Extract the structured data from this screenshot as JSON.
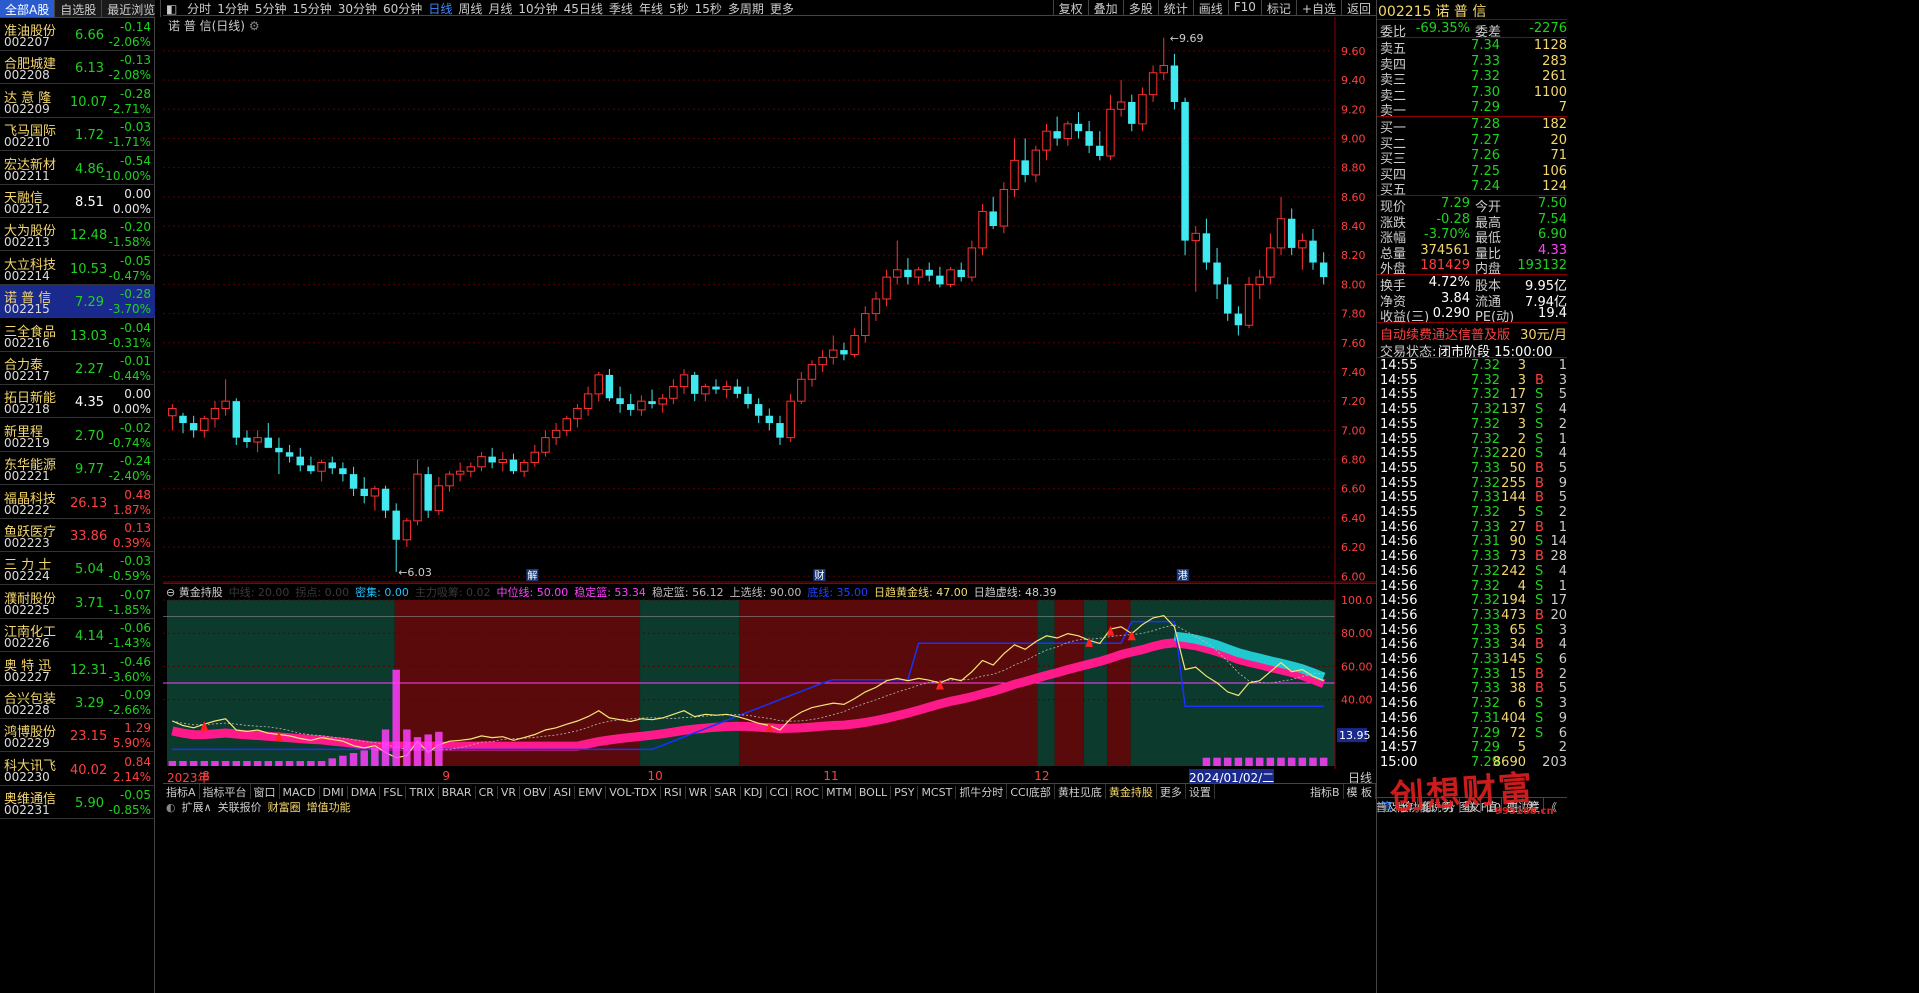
{
  "left_tabs": [
    "全部A股",
    "自选股",
    "最近浏览"
  ],
  "stocks": [
    {
      "name": "准油股份",
      "code": "002207",
      "price": "6.66",
      "chg": "-0.14",
      "pct": "-2.06%",
      "dir": "dn"
    },
    {
      "name": "合肥城建",
      "code": "002208",
      "price": "6.13",
      "chg": "-0.13",
      "pct": "-2.08%",
      "dir": "dn"
    },
    {
      "name": "达 意 隆",
      "code": "002209",
      "price": "10.07",
      "chg": "-0.28",
      "pct": "-2.71%",
      "dir": "dn"
    },
    {
      "name": "飞马国际",
      "code": "002210",
      "price": "1.72",
      "chg": "-0.03",
      "pct": "-1.71%",
      "dir": "dn"
    },
    {
      "name": "宏达新材",
      "code": "002211",
      "price": "4.86",
      "chg": "-0.54",
      "pct": "-10.00%",
      "dir": "dn"
    },
    {
      "name": "天融信",
      "code": "002212",
      "price": "8.51",
      "chg": "0.00",
      "pct": "0.00%",
      "dir": "fl"
    },
    {
      "name": "大为股份",
      "code": "002213",
      "price": "12.48",
      "chg": "-0.20",
      "pct": "-1.58%",
      "dir": "dn"
    },
    {
      "name": "大立科技",
      "code": "002214",
      "price": "10.53",
      "chg": "-0.05",
      "pct": "-0.47%",
      "dir": "dn"
    },
    {
      "name": "诺 普 信",
      "code": "002215",
      "price": "7.29",
      "chg": "-0.28",
      "pct": "-3.70%",
      "dir": "dn",
      "selected": true
    },
    {
      "name": "三全食品",
      "code": "002216",
      "price": "13.03",
      "chg": "-0.04",
      "pct": "-0.31%",
      "dir": "dn"
    },
    {
      "name": "合力泰",
      "code": "002217",
      "price": "2.27",
      "chg": "-0.01",
      "pct": "-0.44%",
      "dir": "dn"
    },
    {
      "name": "拓日新能",
      "code": "002218",
      "price": "4.35",
      "chg": "0.00",
      "pct": "0.00%",
      "dir": "fl"
    },
    {
      "name": "新里程",
      "code": "002219",
      "price": "2.70",
      "chg": "-0.02",
      "pct": "-0.74%",
      "dir": "dn"
    },
    {
      "name": "东华能源",
      "code": "002221",
      "price": "9.77",
      "chg": "-0.24",
      "pct": "-2.40%",
      "dir": "dn"
    },
    {
      "name": "福晶科技",
      "code": "002222",
      "price": "26.13",
      "chg": "0.48",
      "pct": "1.87%",
      "dir": "up"
    },
    {
      "name": "鱼跃医疗",
      "code": "002223",
      "price": "33.86",
      "chg": "0.13",
      "pct": "0.39%",
      "dir": "up"
    },
    {
      "name": "三 力 士",
      "code": "002224",
      "price": "5.04",
      "chg": "-0.03",
      "pct": "-0.59%",
      "dir": "dn"
    },
    {
      "name": "濮耐股份",
      "code": "002225",
      "price": "3.71",
      "chg": "-0.07",
      "pct": "-1.85%",
      "dir": "dn"
    },
    {
      "name": "江南化工",
      "code": "002226",
      "price": "4.14",
      "chg": "-0.06",
      "pct": "-1.43%",
      "dir": "dn"
    },
    {
      "name": "奥 特 迅",
      "code": "002227",
      "price": "12.31",
      "chg": "-0.46",
      "pct": "-3.60%",
      "dir": "dn"
    },
    {
      "name": "合兴包装",
      "code": "002228",
      "price": "3.29",
      "chg": "-0.09",
      "pct": "-2.66%",
      "dir": "dn"
    },
    {
      "name": "鸿博股份",
      "code": "002229",
      "price": "23.15",
      "chg": "1.29",
      "pct": "5.90%",
      "dir": "up"
    },
    {
      "name": "科大讯飞",
      "code": "002230",
      "price": "40.02",
      "chg": "0.84",
      "pct": "2.14%",
      "dir": "up"
    },
    {
      "name": "奥维通信",
      "code": "002231",
      "price": "5.90",
      "chg": "-0.05",
      "pct": "-0.85%",
      "dir": "dn"
    }
  ],
  "period_tabs": [
    "分时",
    "1分钟",
    "5分钟",
    "15分钟",
    "30分钟",
    "60分钟",
    "日线",
    "周线",
    "月线",
    "10分钟",
    "45日线",
    "季线",
    "年线",
    "5秒",
    "15秒",
    "多周期",
    "更多"
  ],
  "active_period": "日线",
  "right_tools": [
    "复权",
    "叠加",
    "多股",
    "统计",
    "画线",
    "F10",
    "标记",
    "+自选",
    "返回"
  ],
  "chart_title": "诺 普 信(日线)",
  "price_ticks": [
    "9.60",
    "9.40",
    "9.20",
    "9.00",
    "8.80",
    "8.60",
    "8.40",
    "8.20",
    "8.00",
    "7.80",
    "7.60",
    "7.40",
    "7.20",
    "7.00",
    "6.80",
    "6.60",
    "6.40",
    "6.20",
    "6.00"
  ],
  "annotations": {
    "high": "9.69",
    "low": "6.03",
    "marker1": "解",
    "marker2": "财",
    "marker3": "港"
  },
  "indicator": {
    "name": "黄金持股",
    "header": [
      {
        "t": "中线: 20.00",
        "c": "#3a3a3a"
      },
      {
        "t": "拐点: 0.00",
        "c": "#3a3a3a"
      },
      {
        "t": "密集: 0.00",
        "c": "#20c0ff"
      },
      {
        "t": "主力吸筹: 0.02",
        "c": "#3a3a3a"
      },
      {
        "t": "中位线: 50.00",
        "c": "#ff40ff"
      },
      {
        "t": "稳定篮: 53.34",
        "c": "#ff40ff"
      },
      {
        "t": "稳定篮: 56.12",
        "c": "#bbbbbb"
      },
      {
        "t": "上选线: 90.00",
        "c": "#bbbbbb"
      },
      {
        "t": "底线: 35.00",
        "c": "#2040ff"
      },
      {
        "t": "日趋黄金线: 47.00",
        "c": "#f5d76e"
      },
      {
        "t": "日趋虚线: 48.39",
        "c": "#cccccc"
      }
    ],
    "ticks": [
      "100.0",
      "80.00",
      "60.00",
      "40.00"
    ],
    "current_label": "13.95"
  },
  "date_labels": [
    {
      "t": "2023年",
      "x": 0.0
    },
    {
      "t": "8",
      "x": 0.03
    },
    {
      "t": "9",
      "x": 0.235
    },
    {
      "t": "10",
      "x": 0.41
    },
    {
      "t": "11",
      "x": 0.56
    },
    {
      "t": "12",
      "x": 0.74
    },
    {
      "t": "2024/01/02/二",
      "x": 0.872
    }
  ],
  "bottom_tabs": [
    "指标A",
    "指标平台",
    "窗口",
    "MACD",
    "DMI",
    "DMA",
    "FSL",
    "TRIX",
    "BRAR",
    "CR",
    "VR",
    "OBV",
    "ASI",
    "EMV",
    "VOL-TDX",
    "RSI",
    "WR",
    "SAR",
    "KDJ",
    "CCI",
    "ROC",
    "MTM",
    "BOLL",
    "PSY",
    "MCST",
    "抓牛分时",
    "CCI底部",
    "黄柱见底",
    "黄金持股",
    "更多",
    "设置"
  ],
  "bottom_tabs_right": [
    "指标B",
    "模 板"
  ],
  "bottom_tabs2": [
    "扩展∧",
    "关联报价",
    "财富圈",
    "增值功能"
  ],
  "bottom_status_right": [
    "普及版功能说明",
    "图文F10",
    "侧边栏",
    "《"
  ],
  "right": {
    "code": "002215",
    "name": "诺 普 信",
    "weibi_label": "委比",
    "weibi": "-69.35%",
    "weicha_label": "委差",
    "weicha": "-2276",
    "sells": [
      {
        "l": "卖五",
        "p": "7.34",
        "v": "1128"
      },
      {
        "l": "卖四",
        "p": "7.33",
        "v": "283"
      },
      {
        "l": "卖三",
        "p": "7.32",
        "v": "261"
      },
      {
        "l": "卖二",
        "p": "7.30",
        "v": "1100"
      },
      {
        "l": "卖一",
        "p": "7.29",
        "v": "7"
      }
    ],
    "buys": [
      {
        "l": "买一",
        "p": "7.28",
        "v": "182"
      },
      {
        "l": "买二",
        "p": "7.27",
        "v": "20"
      },
      {
        "l": "买三",
        "p": "7.26",
        "v": "71"
      },
      {
        "l": "买四",
        "p": "7.25",
        "v": "106"
      },
      {
        "l": "买五",
        "p": "7.24",
        "v": "124"
      }
    ],
    "stats": [
      {
        "l1": "现价",
        "v1": "7.29",
        "c1": "#20d020",
        "l2": "今开",
        "v2": "7.50",
        "c2": "#20d020"
      },
      {
        "l1": "涨跌",
        "v1": "-0.28",
        "c1": "#20d020",
        "l2": "最高",
        "v2": "7.54",
        "c2": "#20d020"
      },
      {
        "l1": "涨幅",
        "v1": "-3.70%",
        "c1": "#20d020",
        "l2": "最低",
        "v2": "6.90",
        "c2": "#20d020"
      },
      {
        "l1": "总量",
        "v1": "374561",
        "c1": "#f5d76e",
        "l2": "量比",
        "v2": "4.33",
        "c2": "#ff40ff"
      },
      {
        "l1": "外盘",
        "v1": "181429",
        "c1": "#ff4040",
        "l2": "内盘",
        "v2": "193132",
        "c2": "#20d020"
      }
    ],
    "stats2": [
      {
        "l1": "换手",
        "v1": "4.72%",
        "l2": "股本",
        "v2": "9.95亿"
      },
      {
        "l1": "净资",
        "v1": "3.84",
        "l2": "流通",
        "v2": "7.94亿"
      },
      {
        "l1": "收益(三)",
        "v1": "0.290",
        "l2": "PE(动)",
        "v2": "19.4"
      }
    ],
    "promo": "自动续费通达信普及版",
    "promo_price": "30元/月",
    "status_label": "交易状态:",
    "status": "闭市阶段 15:00:00",
    "ticks": [
      {
        "t": "14:55",
        "p": "7.32",
        "v": "3",
        "bs": "",
        "n": "1"
      },
      {
        "t": "14:55",
        "p": "7.32",
        "v": "3",
        "bs": "B",
        "n": "3"
      },
      {
        "t": "14:55",
        "p": "7.32",
        "v": "17",
        "bs": "S",
        "n": "5"
      },
      {
        "t": "14:55",
        "p": "7.32",
        "v": "137",
        "bs": "S",
        "n": "4"
      },
      {
        "t": "14:55",
        "p": "7.32",
        "v": "3",
        "bs": "S",
        "n": "2"
      },
      {
        "t": "14:55",
        "p": "7.32",
        "v": "2",
        "bs": "S",
        "n": "1"
      },
      {
        "t": "14:55",
        "p": "7.32",
        "v": "220",
        "bs": "S",
        "n": "4"
      },
      {
        "t": "14:55",
        "p": "7.33",
        "v": "50",
        "bs": "B",
        "n": "5"
      },
      {
        "t": "14:55",
        "p": "7.32",
        "v": "255",
        "bs": "B",
        "n": "9"
      },
      {
        "t": "14:55",
        "p": "7.33",
        "v": "144",
        "bs": "B",
        "n": "5"
      },
      {
        "t": "14:55",
        "p": "7.32",
        "v": "5",
        "bs": "S",
        "n": "2"
      },
      {
        "t": "14:56",
        "p": "7.33",
        "v": "27",
        "bs": "B",
        "n": "1"
      },
      {
        "t": "14:56",
        "p": "7.31",
        "v": "90",
        "bs": "S",
        "n": "14"
      },
      {
        "t": "14:56",
        "p": "7.33",
        "v": "73",
        "bs": "B",
        "n": "28"
      },
      {
        "t": "14:56",
        "p": "7.32",
        "v": "242",
        "bs": "S",
        "n": "4"
      },
      {
        "t": "14:56",
        "p": "7.32",
        "v": "4",
        "bs": "S",
        "n": "1"
      },
      {
        "t": "14:56",
        "p": "7.32",
        "v": "194",
        "bs": "S",
        "n": "17"
      },
      {
        "t": "14:56",
        "p": "7.33",
        "v": "473",
        "bs": "B",
        "n": "20"
      },
      {
        "t": "14:56",
        "p": "7.33",
        "v": "65",
        "bs": "S",
        "n": "3"
      },
      {
        "t": "14:56",
        "p": "7.33",
        "v": "34",
        "bs": "B",
        "n": "4"
      },
      {
        "t": "14:56",
        "p": "7.33",
        "v": "145",
        "bs": "S",
        "n": "6"
      },
      {
        "t": "14:56",
        "p": "7.33",
        "v": "15",
        "bs": "B",
        "n": "2"
      },
      {
        "t": "14:56",
        "p": "7.33",
        "v": "38",
        "bs": "B",
        "n": "5"
      },
      {
        "t": "14:56",
        "p": "7.32",
        "v": "6",
        "bs": "S",
        "n": "3"
      },
      {
        "t": "14:56",
        "p": "7.31",
        "v": "404",
        "bs": "S",
        "n": "9"
      },
      {
        "t": "14:56",
        "p": "7.29",
        "v": "72",
        "bs": "S",
        "n": "6"
      },
      {
        "t": "14:57",
        "p": "7.29",
        "v": "5",
        "bs": "",
        "n": "2"
      },
      {
        "t": "15:00",
        "p": "7.29",
        "v": "8690",
        "bs": "",
        "n": "203"
      }
    ],
    "bottom_tabs": [
      "笔",
      "价",
      "细",
      "势",
      "联",
      "值",
      "主",
      "筹"
    ]
  },
  "watermark": "创想财富",
  "watermark_url": "995168.cn",
  "candles": [
    [
      7.1,
      7.18,
      7.0,
      7.15
    ],
    [
      7.1,
      7.12,
      6.98,
      7.05
    ],
    [
      7.05,
      7.1,
      6.95,
      7.0
    ],
    [
      7.0,
      7.1,
      6.95,
      7.08
    ],
    [
      7.08,
      7.2,
      7.02,
      7.15
    ],
    [
      7.15,
      7.35,
      7.1,
      7.2
    ],
    [
      7.2,
      7.22,
      6.9,
      6.95
    ],
    [
      6.95,
      7.0,
      6.88,
      6.92
    ],
    [
      6.92,
      7.0,
      6.85,
      6.95
    ],
    [
      6.95,
      7.05,
      6.9,
      6.88
    ],
    [
      6.88,
      6.95,
      6.7,
      6.85
    ],
    [
      6.85,
      6.9,
      6.78,
      6.82
    ],
    [
      6.82,
      6.88,
      6.72,
      6.76
    ],
    [
      6.76,
      6.82,
      6.7,
      6.72
    ],
    [
      6.72,
      6.8,
      6.65,
      6.78
    ],
    [
      6.78,
      6.82,
      6.7,
      6.74
    ],
    [
      6.74,
      6.78,
      6.65,
      6.7
    ],
    [
      6.7,
      6.75,
      6.55,
      6.6
    ],
    [
      6.6,
      6.68,
      6.5,
      6.55
    ],
    [
      6.55,
      6.62,
      6.45,
      6.6
    ],
    [
      6.6,
      6.62,
      6.4,
      6.45
    ],
    [
      6.45,
      6.5,
      6.03,
      6.25
    ],
    [
      6.25,
      6.4,
      6.2,
      6.38
    ],
    [
      6.38,
      6.8,
      6.35,
      6.7
    ],
    [
      6.7,
      6.75,
      6.4,
      6.45
    ],
    [
      6.45,
      6.68,
      6.42,
      6.62
    ],
    [
      6.62,
      6.72,
      6.58,
      6.7
    ],
    [
      6.7,
      6.78,
      6.65,
      6.72
    ],
    [
      6.72,
      6.78,
      6.68,
      6.75
    ],
    [
      6.75,
      6.85,
      6.72,
      6.82
    ],
    [
      6.82,
      6.88,
      6.74,
      6.78
    ],
    [
      6.78,
      6.85,
      6.72,
      6.8
    ],
    [
      6.8,
      6.84,
      6.7,
      6.72
    ],
    [
      6.72,
      6.8,
      6.68,
      6.78
    ],
    [
      6.78,
      6.9,
      6.75,
      6.85
    ],
    [
      6.85,
      7.0,
      6.82,
      6.95
    ],
    [
      6.95,
      7.05,
      6.9,
      7.0
    ],
    [
      7.0,
      7.1,
      6.96,
      7.08
    ],
    [
      7.08,
      7.18,
      7.02,
      7.15
    ],
    [
      7.15,
      7.3,
      7.1,
      7.25
    ],
    [
      7.25,
      7.4,
      7.2,
      7.38
    ],
    [
      7.38,
      7.42,
      7.2,
      7.22
    ],
    [
      7.22,
      7.3,
      7.12,
      7.18
    ],
    [
      7.18,
      7.25,
      7.1,
      7.14
    ],
    [
      7.14,
      7.24,
      7.1,
      7.2
    ],
    [
      7.2,
      7.28,
      7.15,
      7.18
    ],
    [
      7.18,
      7.25,
      7.12,
      7.22
    ],
    [
      7.22,
      7.35,
      7.18,
      7.3
    ],
    [
      7.3,
      7.42,
      7.25,
      7.38
    ],
    [
      7.38,
      7.4,
      7.2,
      7.25
    ],
    [
      7.25,
      7.32,
      7.2,
      7.3
    ],
    [
      7.3,
      7.35,
      7.25,
      7.28
    ],
    [
      7.28,
      7.34,
      7.22,
      7.3
    ],
    [
      7.3,
      7.35,
      7.22,
      7.25
    ],
    [
      7.25,
      7.3,
      7.15,
      7.18
    ],
    [
      7.18,
      7.22,
      7.05,
      7.1
    ],
    [
      7.1,
      7.15,
      7.0,
      7.05
    ],
    [
      7.05,
      7.1,
      6.9,
      6.95
    ],
    [
      6.95,
      7.25,
      6.92,
      7.2
    ],
    [
      7.2,
      7.4,
      7.18,
      7.35
    ],
    [
      7.35,
      7.48,
      7.3,
      7.45
    ],
    [
      7.45,
      7.55,
      7.4,
      7.5
    ],
    [
      7.5,
      7.65,
      7.45,
      7.55
    ],
    [
      7.55,
      7.6,
      7.48,
      7.52
    ],
    [
      7.52,
      7.7,
      7.5,
      7.65
    ],
    [
      7.65,
      7.85,
      7.6,
      7.8
    ],
    [
      7.8,
      7.95,
      7.75,
      7.9
    ],
    [
      7.9,
      8.1,
      7.85,
      8.05
    ],
    [
      8.05,
      8.3,
      8.0,
      8.1
    ],
    [
      8.1,
      8.18,
      8.0,
      8.05
    ],
    [
      8.05,
      8.12,
      8.0,
      8.1
    ],
    [
      8.1,
      8.15,
      8.02,
      8.06
    ],
    [
      8.06,
      8.12,
      7.98,
      8.0
    ],
    [
      8.0,
      8.12,
      7.98,
      8.1
    ],
    [
      8.1,
      8.15,
      8.02,
      8.05
    ],
    [
      8.05,
      8.3,
      8.02,
      8.25
    ],
    [
      8.25,
      8.55,
      8.2,
      8.5
    ],
    [
      8.5,
      8.6,
      8.38,
      8.4
    ],
    [
      8.4,
      8.7,
      8.35,
      8.65
    ],
    [
      8.65,
      9.0,
      8.6,
      8.85
    ],
    [
      8.85,
      9.0,
      8.7,
      8.75
    ],
    [
      8.75,
      8.95,
      8.7,
      8.92
    ],
    [
      8.92,
      9.1,
      8.85,
      9.05
    ],
    [
      9.05,
      9.15,
      8.95,
      9.0
    ],
    [
      9.0,
      9.12,
      8.95,
      9.1
    ],
    [
      9.1,
      9.18,
      9.0,
      9.05
    ],
    [
      9.05,
      9.12,
      8.9,
      8.95
    ],
    [
      8.95,
      9.05,
      8.85,
      8.88
    ],
    [
      8.88,
      9.3,
      8.85,
      9.2
    ],
    [
      9.2,
      9.4,
      9.15,
      9.25
    ],
    [
      9.25,
      9.3,
      9.05,
      9.1
    ],
    [
      9.1,
      9.35,
      9.05,
      9.3
    ],
    [
      9.3,
      9.5,
      9.25,
      9.45
    ],
    [
      9.45,
      9.69,
      9.4,
      9.5
    ],
    [
      9.5,
      9.58,
      9.2,
      9.25
    ],
    [
      9.25,
      9.28,
      8.2,
      8.3
    ],
    [
      8.3,
      8.4,
      7.95,
      8.35
    ],
    [
      8.35,
      8.45,
      8.1,
      8.15
    ],
    [
      8.15,
      8.25,
      7.9,
      8.0
    ],
    [
      8.0,
      8.05,
      7.75,
      7.8
    ],
    [
      7.8,
      7.85,
      7.65,
      7.72
    ],
    [
      7.72,
      8.05,
      7.7,
      8.0
    ],
    [
      8.0,
      8.1,
      7.9,
      8.05
    ],
    [
      8.05,
      8.35,
      8.0,
      8.25
    ],
    [
      8.25,
      8.6,
      8.2,
      8.45
    ],
    [
      8.45,
      8.52,
      8.2,
      8.25
    ],
    [
      8.25,
      8.35,
      8.1,
      8.3
    ],
    [
      8.3,
      8.38,
      8.1,
      8.15
    ],
    [
      8.15,
      8.22,
      8.0,
      8.05
    ]
  ]
}
